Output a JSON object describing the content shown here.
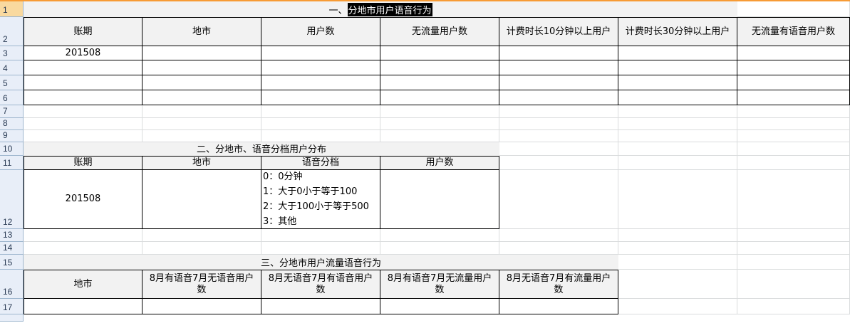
{
  "row_numbers": [
    "1",
    "2",
    "3",
    "4",
    "5",
    "6",
    "7",
    "8",
    "9",
    "10",
    "11",
    "12",
    "13",
    "14",
    "15",
    "16",
    "17"
  ],
  "section1": {
    "title_prefix": "一、",
    "title_selected": "分地市用户语音行为",
    "headers": [
      "账期",
      "地市",
      "用户数",
      "无流量用户数",
      "计费时长10分钟以上用户",
      "计费时长30分钟以上用户",
      "无流量有语音用户数"
    ],
    "period_value": "201508"
  },
  "section2": {
    "title": "二、分地市、语音分档用户分布",
    "headers": [
      "账期",
      "地市",
      "语音分档",
      "用户数"
    ],
    "period_value": "201508",
    "voice_tiers": [
      "0：0分钟",
      "1：大于0小于等于100",
      "2：大于100小于等于500",
      "3：其他"
    ]
  },
  "section3": {
    "title": "三、分地市用户流量语音行为",
    "headers": [
      "地市",
      "8月有语音7月无语音用户数",
      "8月无语音7月有语音用户数",
      "8月有语音7月无流量用户数",
      "8月无语音7月有流量用户数"
    ]
  },
  "colors": {
    "row_header_bg": "#e8eef8",
    "selected_row_header": "#f9d99f",
    "header_fill": "#f2f2f2",
    "gridline": "#dadcdd",
    "top_bar": "#f79b35"
  }
}
